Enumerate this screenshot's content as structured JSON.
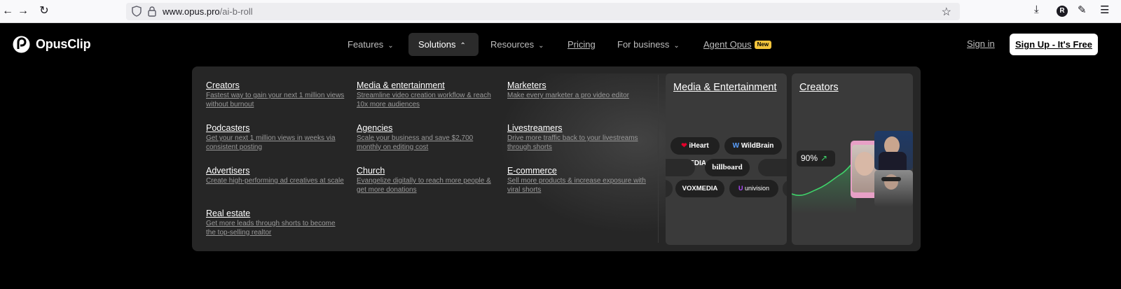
{
  "browser": {
    "url_host": "www.opus.pro",
    "url_path": "/ai-b-roll",
    "avatar_letter": "R"
  },
  "header": {
    "logo_text": "OpusClip",
    "nav": [
      {
        "label": "Features"
      },
      {
        "label": "Solutions"
      },
      {
        "label": "Resources"
      },
      {
        "label": "Pricing"
      },
      {
        "label": "For business"
      },
      {
        "label": "Agent Opus",
        "badge": "New"
      }
    ],
    "signin": "Sign in",
    "signup": "Sign Up - It's Free"
  },
  "solutions": {
    "items": [
      {
        "title": "Creators",
        "desc": "Fastest way to gain your next 1 million views without burnout"
      },
      {
        "title": "Media & entertainment",
        "desc": "Streamline video creation workflow & reach 10x more audiences"
      },
      {
        "title": "Marketers",
        "desc": "Make every marketer a pro video editor"
      },
      {
        "title": "Podcasters",
        "desc": "Get your next 1 million views in weeks via consistent posting"
      },
      {
        "title": "Agencies",
        "desc": "Scale your business and save $2,700 monthly on editing cost"
      },
      {
        "title": "Livestreamers",
        "desc": "Drive more traffic back to your livestreams through shorts"
      },
      {
        "title": "Advertisers",
        "desc": "Create high-performing ad creatives at scale"
      },
      {
        "title": "Church",
        "desc": "Evangelize digitally to reach more people & get more donations"
      },
      {
        "title": "E-commerce",
        "desc": "Sell more products & increase exposure with viral shorts"
      },
      {
        "title": "Real estate",
        "desc": "Get more leads through shorts to become the top-selling realtor"
      }
    ],
    "cards": {
      "media": {
        "title": "Media & Entertainment",
        "logos": [
          "iHeart MEDIA",
          "WildBrain",
          "billboard",
          "VOXMEDIA",
          "univision"
        ]
      },
      "creators": {
        "title": "Creators",
        "stat": "90%"
      }
    }
  },
  "colors": {
    "panel_bg": "#262626",
    "card_bg": "#3a3a3a",
    "accent_green": "#3fd46a",
    "badge_yellow": "#f3c43b"
  }
}
